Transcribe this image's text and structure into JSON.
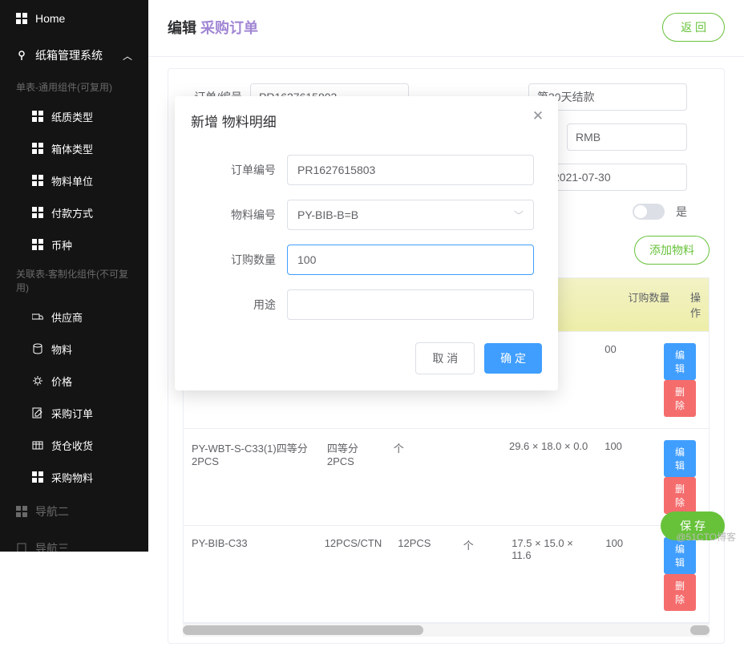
{
  "sidebar": {
    "home": "Home",
    "group1": "纸箱管理系统",
    "section1": "单表-通用组件(可复用)",
    "sub1": [
      "纸质类型",
      "箱体类型",
      "物料单位",
      "付款方式",
      "币种"
    ],
    "section2": "关联表-客制化组件(不可复用)",
    "sub2": [
      {
        "label": "供应商",
        "icon": "truck"
      },
      {
        "label": "物料",
        "icon": "db"
      },
      {
        "label": "价格",
        "icon": "gear"
      },
      {
        "label": "采购订单",
        "icon": "edit"
      },
      {
        "label": "货仓收货",
        "icon": "crate"
      },
      {
        "label": "采购物料",
        "icon": "grid"
      }
    ],
    "nav2": "导航二",
    "nav3": "导航三"
  },
  "header": {
    "edit": "编辑",
    "title": "采购订单",
    "back": "返 回"
  },
  "bgform": {
    "field1_label": "订单/编号",
    "field1_value": "PR1627615803",
    "pay_value": "第30天结款",
    "currency_value": "RMB",
    "date_value": "2021-07-30",
    "toggle_label": "是",
    "add_btn": "添加物料"
  },
  "table": {
    "headers": [
      "",
      "",
      "",
      "",
      "",
      "订购数量",
      "操作"
    ],
    "rows": [
      {
        "c1": "",
        "c2": "",
        "c3": "",
        "c4": "",
        "c5": "",
        "c6": "00"
      },
      {
        "c1": "PY-WBT-S-C33(1)四等分2PCS",
        "c2": "四等分2PCS",
        "c3": "个",
        "c4": "",
        "c5": "29.6 × 18.0 × 0.0",
        "c6": "100"
      },
      {
        "c1": "PY-BIB-C33",
        "c2": "12PCS/CTN",
        "c3": "12PCS",
        "c4": "个",
        "c5": "17.5 × 15.0 × 11.6",
        "c6": "100"
      }
    ],
    "edit": "编辑",
    "del": "删除"
  },
  "modal": {
    "title": "新增 物料明细",
    "f1": "订单编号",
    "v1": "PR1627615803",
    "f2": "物料编号",
    "v2": "PY-BIB-B=B",
    "f3": "订购数量",
    "v3": "100",
    "f4": "用途",
    "v4": "",
    "cancel": "取 消",
    "ok": "确 定"
  },
  "save": "保 存",
  "watermark": "@51CTO博客"
}
